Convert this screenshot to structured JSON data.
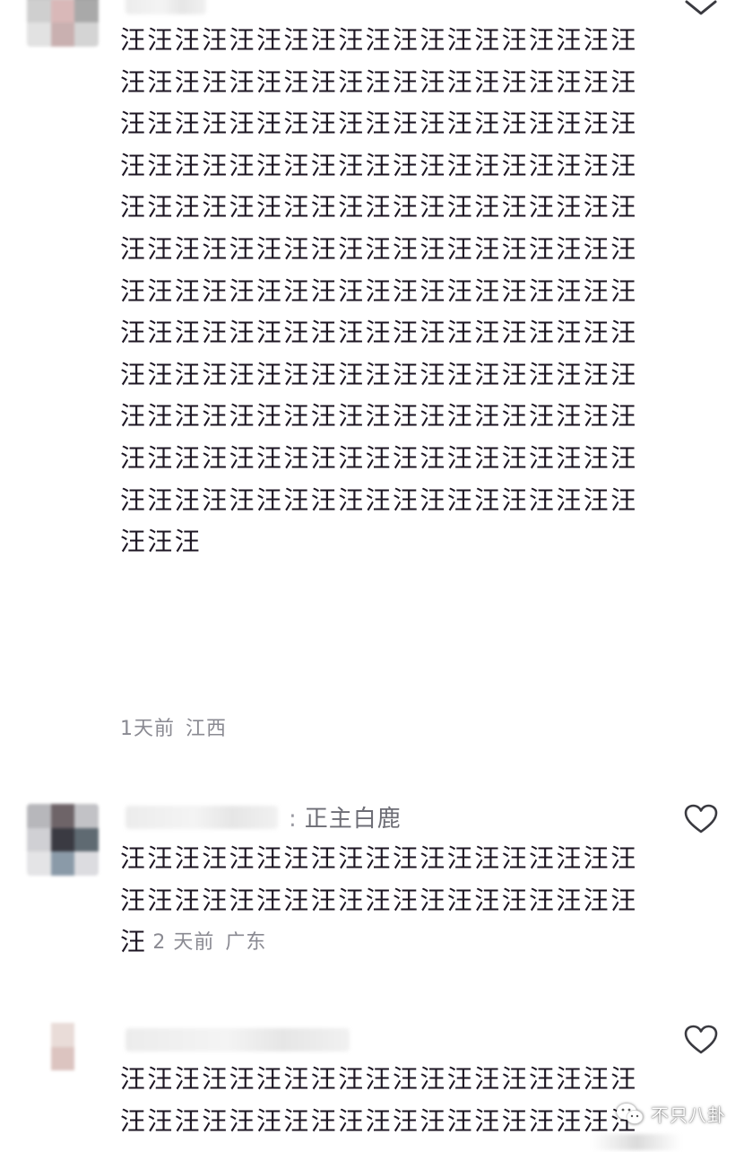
{
  "colors": {
    "body_text": "#1d1623",
    "meta_text": "#8a8a92",
    "reply_text": "#6d6d75",
    "heart_stroke": "#3a3a40"
  },
  "icons": {
    "collapse": "chevron-down-icon",
    "like": "heart-outline-icon",
    "watermark": "wechat-icon"
  },
  "comments": [
    {
      "text": "汪汪汪汪汪汪汪汪汪汪汪汪汪汪汪汪汪汪汪汪汪汪汪汪汪汪汪汪汪汪汪汪汪汪汪汪汪汪汪汪汪汪汪汪汪汪汪汪汪汪汪汪汪汪汪汪汪汪汪汪汪汪汪汪汪汪汪汪汪汪汪汪汪汪汪汪汪汪汪汪汪汪汪汪汪汪汪汪汪汪汪汪汪汪汪汪汪汪汪汪汪汪汪汪汪汪汪汪汪汪汪汪汪汪汪汪汪汪汪汪汪汪汪汪汪汪汪汪汪汪汪汪汪汪汪汪汪汪汪汪汪汪汪汪汪汪汪汪汪汪汪汪汪汪汪汪汪汪汪汪汪汪汪汪汪汪汪汪汪汪汪汪汪汪汪汪汪汪汪汪汪汪汪汪汪汪汪汪汪汪汪汪汪汪汪汪汪汪汪汪汪汪汪汪汪汪汪汪汪汪汪汪汪汪汪汪汪汪汪汪汪汪汪汪汪汪汪汪汪汪汪",
      "time": "1天前",
      "location": "江西"
    },
    {
      "reply_to": "正主白鹿",
      "text": "汪汪汪汪汪汪汪汪汪汪汪汪汪汪汪汪汪汪汪汪汪汪汪汪汪汪汪汪汪汪汪汪汪汪汪汪汪汪汪",
      "time": "2 天前",
      "location": "广东"
    },
    {
      "text": "汪汪汪汪汪汪汪汪汪汪汪汪汪汪汪汪汪汪汪汪汪汪汪汪汪汪汪汪汪汪汪汪汪汪汪汪汪汪"
    }
  ],
  "watermark": {
    "label": "不只八卦"
  }
}
